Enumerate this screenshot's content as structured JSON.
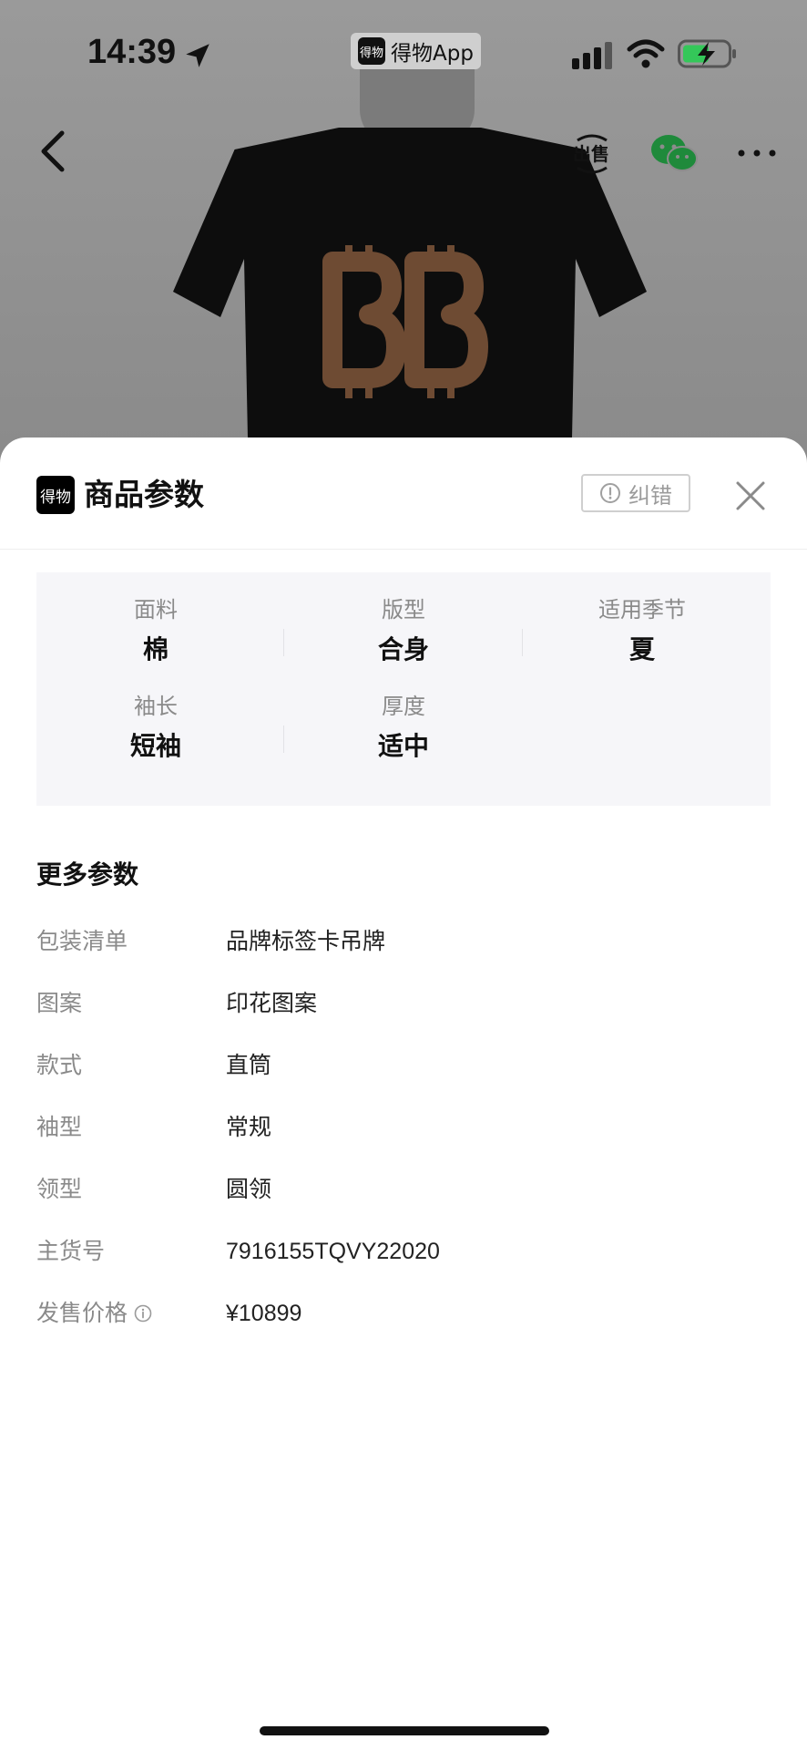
{
  "status_bar": {
    "time": "14:39",
    "app_name": "得物App",
    "app_logo_text": "得物"
  },
  "nav": {
    "back_icon": "chevron-left-icon",
    "sell_icon": "sell-icon",
    "sell_icon_text": "出售",
    "wechat_icon": "wechat-icon",
    "more_icon": "more-dots-icon"
  },
  "sheet": {
    "logo_text": "得物",
    "title": "商品参数",
    "report_label": "纠错",
    "close_icon": "close-icon"
  },
  "key_params": [
    {
      "label": "面料",
      "value": "棉"
    },
    {
      "label": "版型",
      "value": "合身"
    },
    {
      "label": "适用季节",
      "value": "夏"
    },
    {
      "label": "袖长",
      "value": "短袖"
    },
    {
      "label": "厚度",
      "value": "适中"
    }
  ],
  "more_params": {
    "title": "更多参数",
    "rows": [
      {
        "label": "包装清单",
        "value": "品牌标签卡吊牌"
      },
      {
        "label": "图案",
        "value": "印花图案"
      },
      {
        "label": "款式",
        "value": "直筒"
      },
      {
        "label": "袖型",
        "value": "常规"
      },
      {
        "label": "领型",
        "value": "圆领"
      },
      {
        "label": "主货号",
        "value": "7916155TQVY22020"
      },
      {
        "label": "发售价格",
        "value": "¥10899",
        "has_info_icon": true
      }
    ]
  },
  "colors": {
    "overlay_bg": "#8c8c8c",
    "sheet_bg": "#ffffff",
    "params_bg": "#f6f6f9",
    "label_gray": "#8a8a8a",
    "wechat_green": "#1f8a3b",
    "battery_green": "#34c759"
  }
}
